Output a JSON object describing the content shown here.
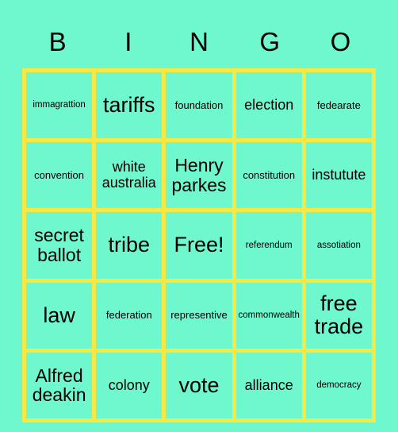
{
  "colors": {
    "background": "#6ff7ce",
    "grid_line": "#f7e942",
    "cell_fill": "#6ff7ce",
    "text": "#000000"
  },
  "header": {
    "letters": [
      "B",
      "I",
      "N",
      "G",
      "O"
    ]
  },
  "grid": {
    "rows": 5,
    "columns": 5,
    "cells": [
      [
        {
          "text": "immagrattion",
          "size": "s-xs",
          "free": false
        },
        {
          "text": "tariffs",
          "size": "s-xl",
          "free": false
        },
        {
          "text": "foundation",
          "size": "s-sm",
          "free": false
        },
        {
          "text": "election",
          "size": "s-md",
          "free": false
        },
        {
          "text": "fedearate",
          "size": "s-sm",
          "free": false
        }
      ],
      [
        {
          "text": "convention",
          "size": "s-sm",
          "free": false
        },
        {
          "text": "white australia",
          "size": "s-md",
          "free": false
        },
        {
          "text": "Henry parkes",
          "size": "s-lg",
          "free": false
        },
        {
          "text": "constitution",
          "size": "s-sm",
          "free": false
        },
        {
          "text": "instutute",
          "size": "s-md",
          "free": false
        }
      ],
      [
        {
          "text": "secret ballot",
          "size": "s-lg",
          "free": false
        },
        {
          "text": "tribe",
          "size": "s-xl",
          "free": false
        },
        {
          "text": "Free!",
          "size": "s-xl",
          "free": true
        },
        {
          "text": "referendum",
          "size": "s-xs",
          "free": false
        },
        {
          "text": "assotiation",
          "size": "s-xs",
          "free": false
        }
      ],
      [
        {
          "text": "law",
          "size": "s-xl",
          "free": false
        },
        {
          "text": "federation",
          "size": "s-sm",
          "free": false
        },
        {
          "text": "representive",
          "size": "s-sm",
          "free": false
        },
        {
          "text": "commonwealth",
          "size": "s-xs",
          "free": false
        },
        {
          "text": "free trade",
          "size": "s-xl",
          "free": false
        }
      ],
      [
        {
          "text": "Alfred deakin",
          "size": "s-lg",
          "free": false
        },
        {
          "text": "colony",
          "size": "s-md",
          "free": false
        },
        {
          "text": "vote",
          "size": "s-xl",
          "free": false
        },
        {
          "text": "alliance",
          "size": "s-md",
          "free": false
        },
        {
          "text": "democracy",
          "size": "s-xs",
          "free": false
        }
      ]
    ]
  }
}
